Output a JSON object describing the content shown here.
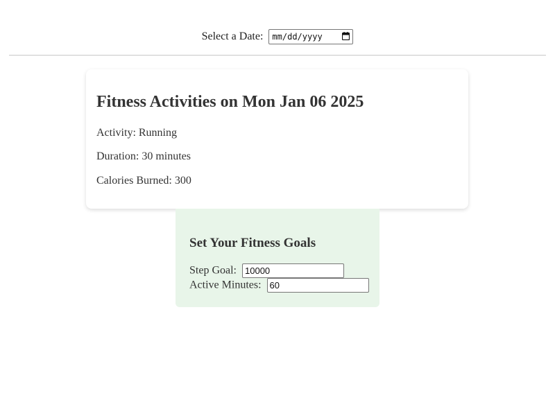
{
  "date_picker": {
    "label": "Select a Date:",
    "placeholder": "mm/dd/yyyy"
  },
  "activity_card": {
    "title": "Fitness Activities on Mon Jan 06 2025",
    "activity": "Activity: Running",
    "duration": "Duration: 30 minutes",
    "calories": "Calories Burned: 300"
  },
  "goals": {
    "title": "Set Your Fitness Goals",
    "step_goal_label": "Step Goal:",
    "step_goal_value": "10000",
    "active_minutes_label": "Active Minutes:",
    "active_minutes_value": "60"
  },
  "colors": {
    "goals_background": "#e8f5e9",
    "card_background": "#ffffff",
    "text": "#333333"
  },
  "icons": {
    "date_picker_icon": "calendar-icon"
  }
}
